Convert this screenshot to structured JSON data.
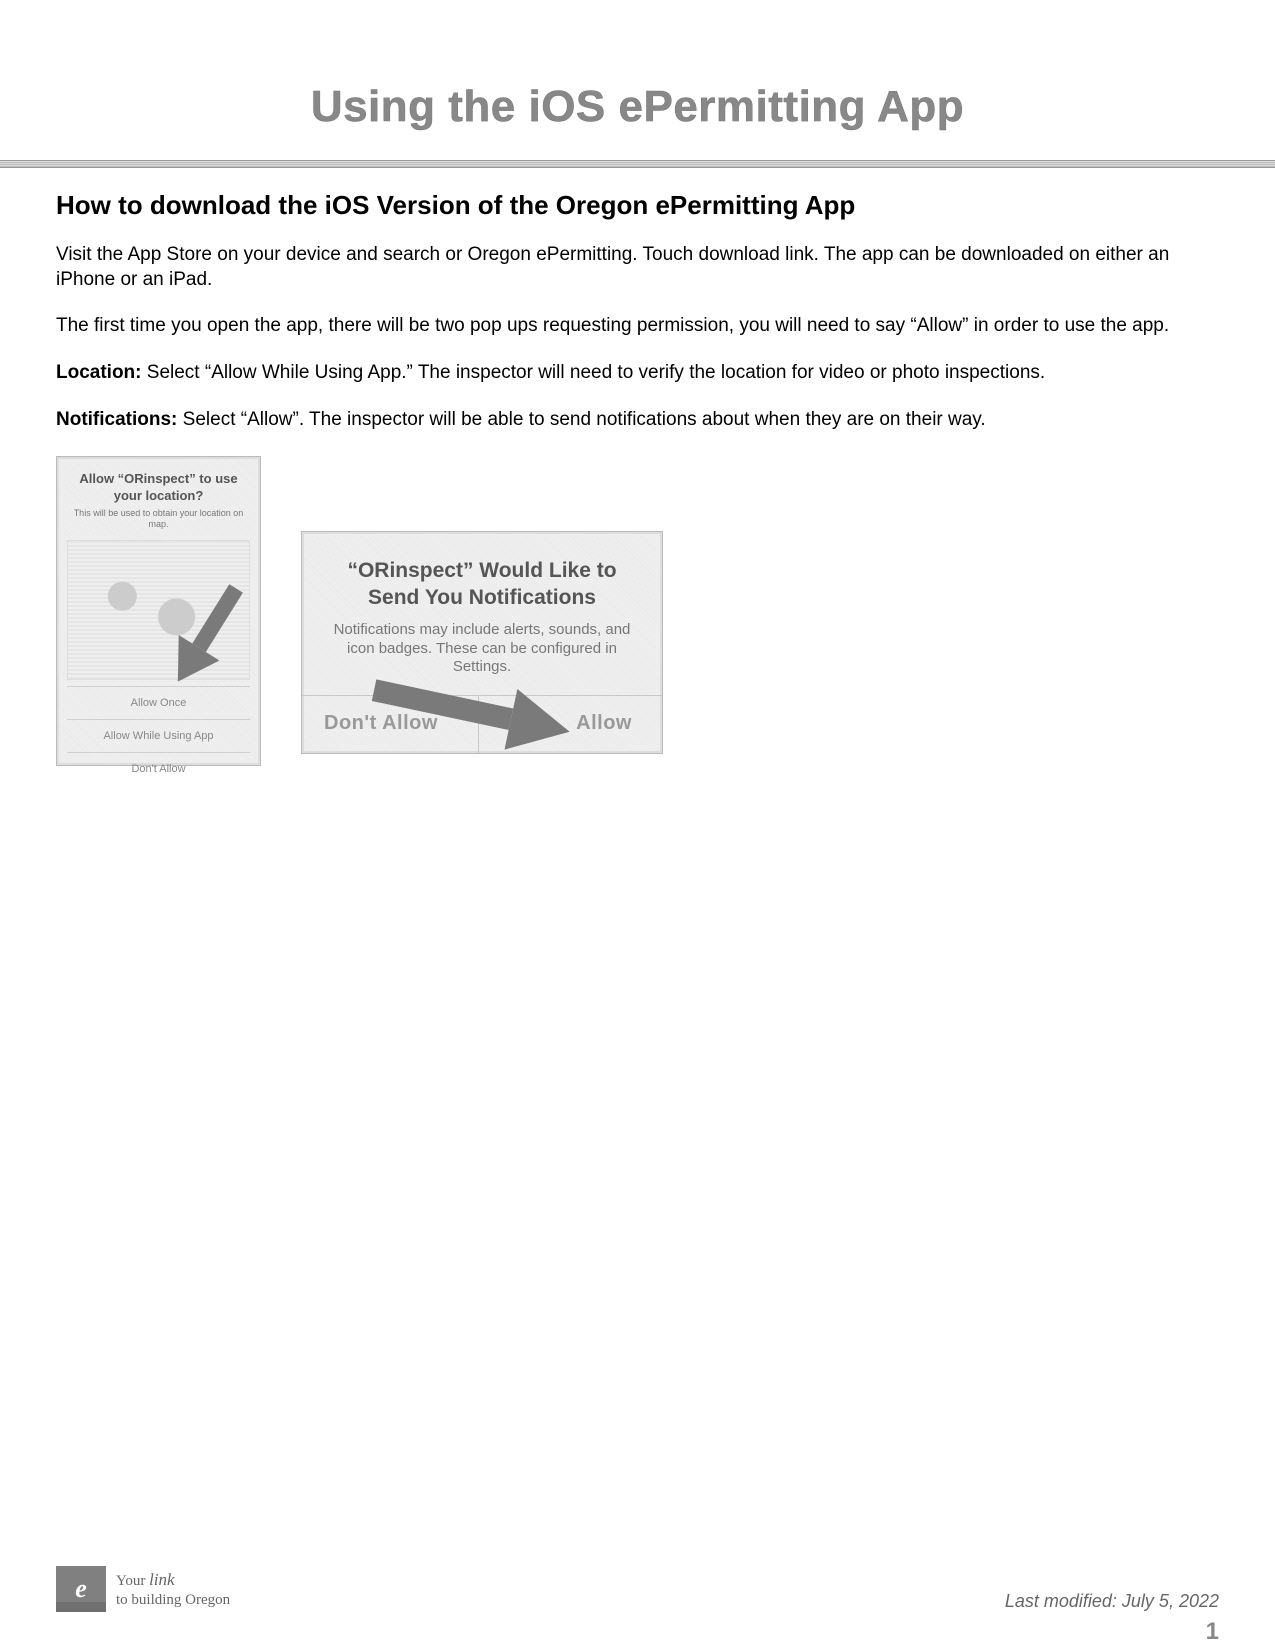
{
  "page": {
    "title": "Using the iOS ePermitting App",
    "section_heading": "How to download the iOS Version of the Oregon ePermitting App",
    "p1": "Visit the App Store on your device and search or Oregon ePermitting. Touch download link. The app can be downloaded on either an iPhone or an iPad.",
    "p2": "The first time you open the app, there will be two pop ups requesting permission, you will need to say “Allow” in order to use the app.",
    "p3_label": "Location:",
    "p3_text": " Select “Allow While Using App.” The inspector will need to verify the location for video or photo inspections.",
    "p4_label": "Notifications:",
    "p4_text": " Select “Allow”. The inspector will be able to send notifications about when they are on their way."
  },
  "screenshot1": {
    "title": "Allow “ORinspect” to use your location?",
    "sub": "This will be used to obtain your location on map.",
    "opt1": "Allow Once",
    "opt2": "Allow While Using App",
    "opt3": "Don't Allow"
  },
  "screenshot2": {
    "title": "“ORinspect” Would Like to Send You Notifications",
    "sub": "Notifications may include alerts, sounds, and icon badges. These can be configured in Settings.",
    "btn_left": "Don't Allow",
    "btn_right": "Allow"
  },
  "footer": {
    "logo_letter": "e",
    "slogan_line1_prefix": "Your ",
    "slogan_line1_script": "link",
    "slogan_line2": "to building Oregon",
    "last_modified": "Last modified: July 5, 2022",
    "page_number": "1"
  }
}
